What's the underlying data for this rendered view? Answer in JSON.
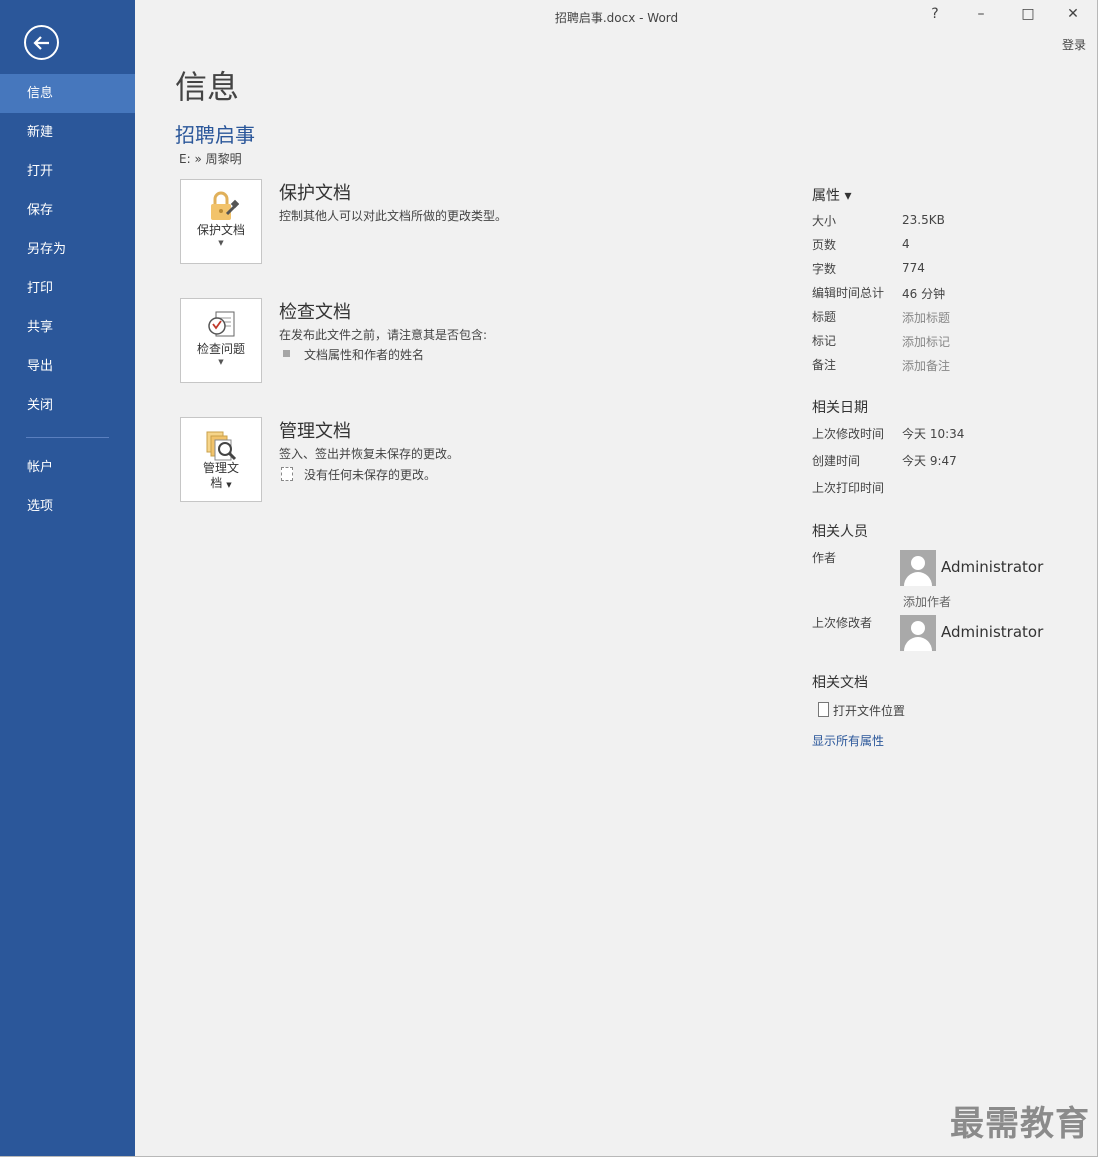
{
  "window": {
    "title": "招聘启事.docx - Word",
    "help": "?",
    "minimize": "–",
    "maximize": "□",
    "close": "✕",
    "login": "登录"
  },
  "sidebar": {
    "items": [
      {
        "label": "信息"
      },
      {
        "label": "新建"
      },
      {
        "label": "打开"
      },
      {
        "label": "保存"
      },
      {
        "label": "另存为"
      },
      {
        "label": "打印"
      },
      {
        "label": "共享"
      },
      {
        "label": "导出"
      },
      {
        "label": "关闭"
      },
      {
        "label": "帐户"
      },
      {
        "label": "选项"
      }
    ]
  },
  "main": {
    "heading": "信息",
    "doc_title": "招聘启事",
    "doc_path": "E: » 周黎明",
    "protect": {
      "button_label": "保护文档",
      "title": "保护文档",
      "desc": "控制其他人可以对此文档所做的更改类型。"
    },
    "inspect": {
      "button_label": "检查问题",
      "title": "检查文档",
      "desc": "在发布此文件之前，请注意其是否包含:",
      "item": "文档属性和作者的姓名"
    },
    "manage": {
      "button_label_1": "管理文",
      "button_label_2": "档",
      "title": "管理文档",
      "desc": "签入、签出并恢复未保存的更改。",
      "item": "没有任何未保存的更改。"
    }
  },
  "properties": {
    "heading": "属性 ▾",
    "rows": [
      {
        "key": "大小",
        "value": "23.5KB"
      },
      {
        "key": "页数",
        "value": "4"
      },
      {
        "key": "字数",
        "value": "774"
      },
      {
        "key": "编辑时间总计",
        "value": "46 分钟"
      },
      {
        "key": "标题",
        "value": "添加标题"
      },
      {
        "key": "标记",
        "value": "添加标记"
      },
      {
        "key": "备注",
        "value": "添加备注"
      }
    ],
    "dates_heading": "相关日期",
    "dates": [
      {
        "key": "上次修改时间",
        "value": "今天 10:34"
      },
      {
        "key": "创建时间",
        "value": "今天 9:47"
      },
      {
        "key": "上次打印时间",
        "value": ""
      }
    ],
    "people_heading": "相关人员",
    "author_key": "作者",
    "author_name": "Administrator",
    "add_author": "添加作者",
    "last_modified_key": "上次修改者",
    "last_modified_name": "Administrator",
    "docs_heading": "相关文档",
    "open_location": "打开文件位置",
    "show_all": "显示所有属性"
  },
  "watermark": "最需教育"
}
